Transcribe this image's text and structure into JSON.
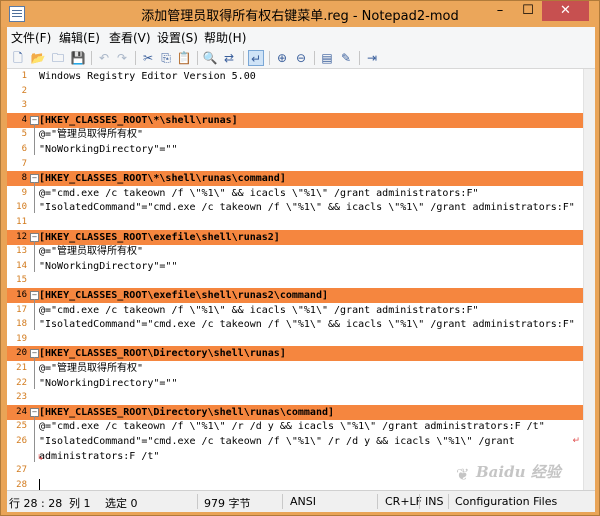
{
  "window": {
    "title": "添加管理员取得所有权右键菜单.reg - Notepad2-mod",
    "min_label": "–",
    "max_label": "☐",
    "close_label": "✕"
  },
  "menu": [
    "文件(F)",
    "编辑(E)",
    "查看(V)",
    "设置(S)",
    "帮助(H)"
  ],
  "toolbar_icons": [
    "new-file-icon",
    "open-folder-icon",
    "browse-icon",
    "save-icon",
    "undo-icon",
    "redo-icon",
    "cut-icon",
    "copy-icon",
    "paste-icon",
    "find-icon",
    "replace-icon",
    "word-wrap-icon",
    "zoom-in-icon",
    "zoom-out-icon",
    "scheme-icon",
    "customize-icon",
    "exit-icon"
  ],
  "editor": {
    "lines": [
      {
        "n": "1",
        "text": "Windows Registry Editor Version 5.00",
        "section": false
      },
      {
        "n": "2",
        "text": "",
        "section": false
      },
      {
        "n": "3",
        "text": "",
        "section": false
      },
      {
        "n": "4",
        "text": "[HKEY_CLASSES_ROOT\\*\\shell\\runas]",
        "section": true
      },
      {
        "n": "5",
        "text": "@=\"管理员取得所有权\"",
        "section": false
      },
      {
        "n": "6",
        "text": "\"NoWorkingDirectory\"=\"\"",
        "section": false
      },
      {
        "n": "7",
        "text": "",
        "section": false
      },
      {
        "n": "8",
        "text": "[HKEY_CLASSES_ROOT\\*\\shell\\runas\\command]",
        "section": true
      },
      {
        "n": "9",
        "text": "@=\"cmd.exe /c takeown /f \\\"%1\\\" && icacls \\\"%1\\\" /grant administrators:F\"",
        "section": false
      },
      {
        "n": "10",
        "text": "\"IsolatedCommand\"=\"cmd.exe /c takeown /f \\\"%1\\\" && icacls \\\"%1\\\" /grant administrators:F\"",
        "section": false
      },
      {
        "n": "11",
        "text": "",
        "section": false
      },
      {
        "n": "12",
        "text": "[HKEY_CLASSES_ROOT\\exefile\\shell\\runas2]",
        "section": true
      },
      {
        "n": "13",
        "text": "@=\"管理员取得所有权\"",
        "section": false
      },
      {
        "n": "14",
        "text": "\"NoWorkingDirectory\"=\"\"",
        "section": false
      },
      {
        "n": "15",
        "text": "",
        "section": false
      },
      {
        "n": "16",
        "text": "[HKEY_CLASSES_ROOT\\exefile\\shell\\runas2\\command]",
        "section": true
      },
      {
        "n": "17",
        "text": "@=\"cmd.exe /c takeown /f \\\"%1\\\" && icacls \\\"%1\\\" /grant administrators:F\"",
        "section": false
      },
      {
        "n": "18",
        "text": "\"IsolatedCommand\"=\"cmd.exe /c takeown /f \\\"%1\\\" && icacls \\\"%1\\\" /grant administrators:F\"",
        "section": false
      },
      {
        "n": "19",
        "text": "",
        "section": false
      },
      {
        "n": "20",
        "text": "[HKEY_CLASSES_ROOT\\Directory\\shell\\runas]",
        "section": true
      },
      {
        "n": "21",
        "text": "@=\"管理员取得所有权\"",
        "section": false
      },
      {
        "n": "22",
        "text": "\"NoWorkingDirectory\"=\"\"",
        "section": false
      },
      {
        "n": "23",
        "text": "",
        "section": false
      },
      {
        "n": "24",
        "text": "[HKEY_CLASSES_ROOT\\Directory\\shell\\runas\\command]",
        "section": true
      },
      {
        "n": "25",
        "text": "@=\"cmd.exe /c takeown /f \\\"%1\\\" /r /d y && icacls \\\"%1\\\" /grant administrators:F /t\"",
        "section": false
      },
      {
        "n": "26",
        "text": "\"IsolatedCommand\"=\"cmd.exe /c takeown /f \\\"%1\\\" /r /d y && icacls \\\"%1\\\" /grant",
        "section": false
      },
      {
        "n": "",
        "text": "administrators:F /t\"",
        "section": false
      },
      {
        "n": "27",
        "text": "",
        "section": false
      },
      {
        "n": "28",
        "text": "",
        "section": false
      }
    ]
  },
  "status": {
    "position": "行 28 : 28",
    "column": "列 1",
    "selection": "选定 0",
    "size": "979 字节",
    "encoding": "ANSI",
    "line_ending": "CR+LF",
    "mode": "INS",
    "scheme": "Configuration Files"
  },
  "watermark": "Baidu 经验"
}
